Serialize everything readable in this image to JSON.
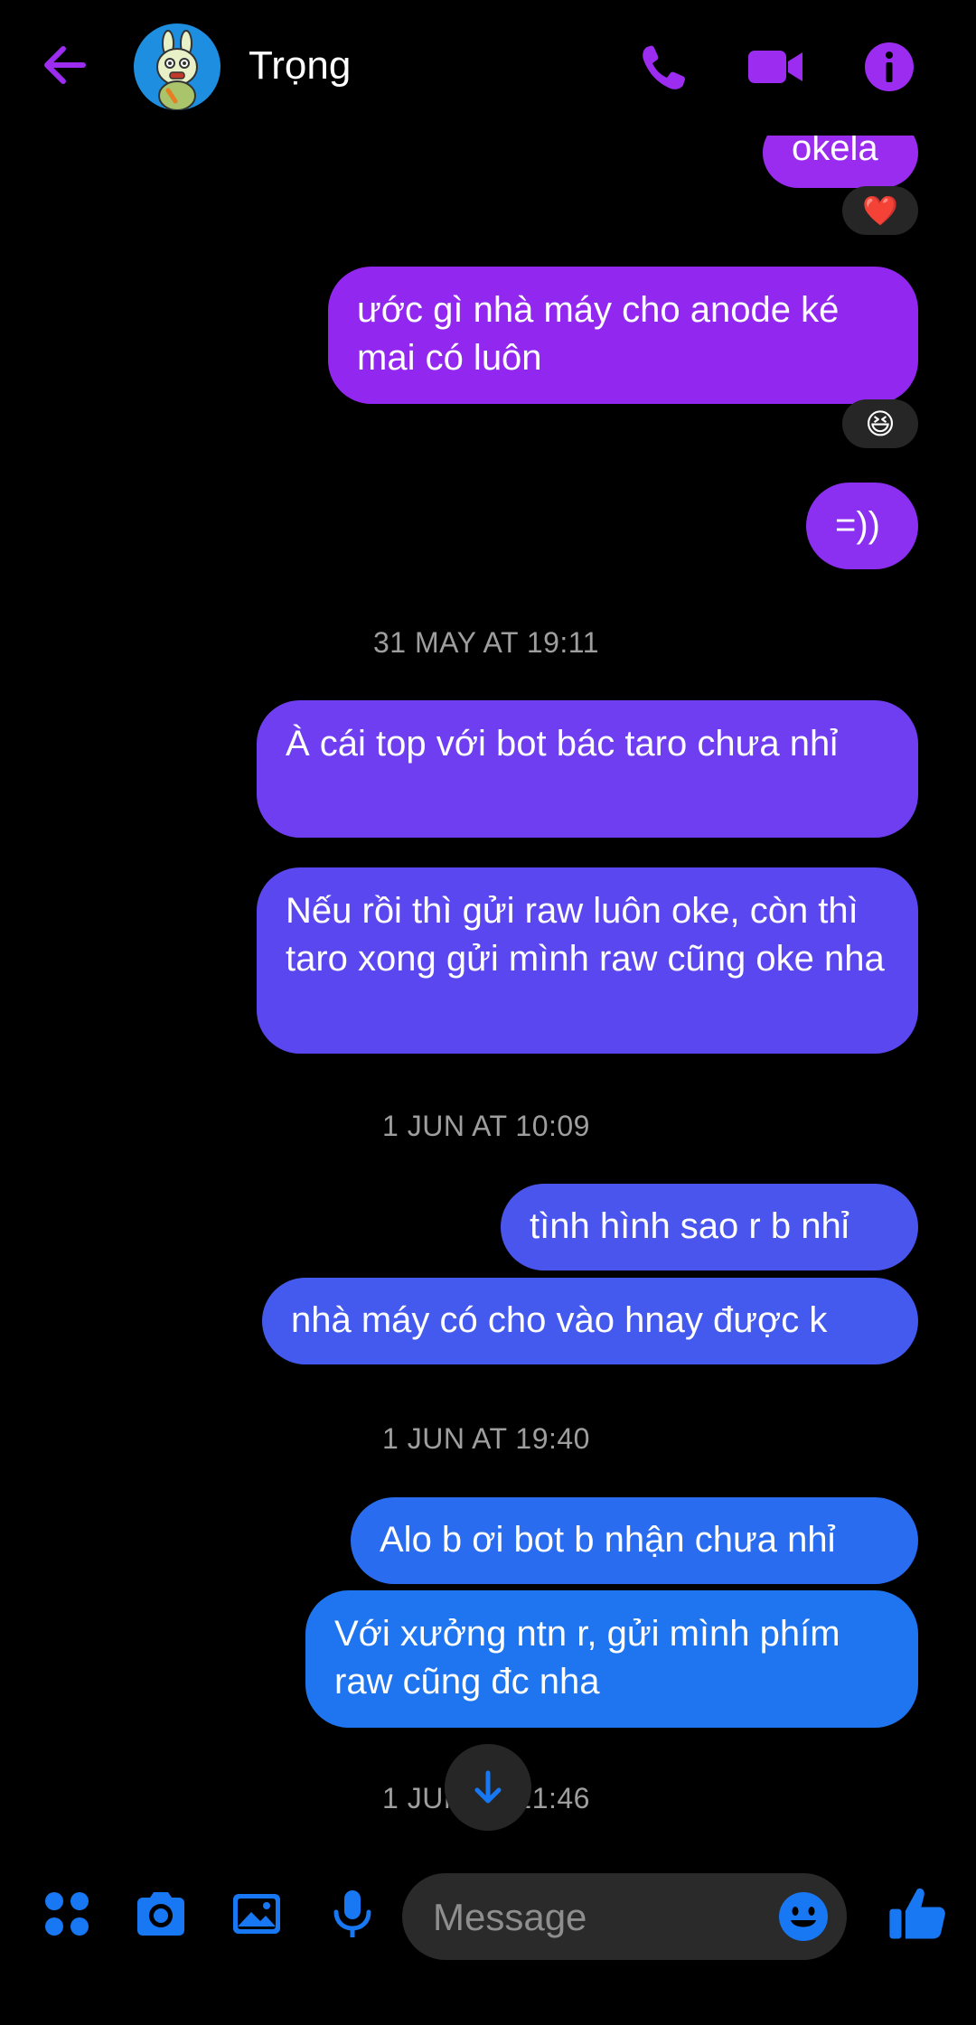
{
  "header": {
    "contact_name": "Trọng",
    "back_icon": "arrow-left-icon",
    "call_icon": "phone-icon",
    "video_icon": "video-camera-icon",
    "info_icon": "info-icon",
    "accent_color": "#9b2cf0"
  },
  "messages": [
    {
      "text": "okela",
      "reaction": "❤️"
    },
    {
      "text": "ước gì nhà máy cho anode ké mai có luôn",
      "reaction": "😆"
    },
    {
      "text": "=))"
    },
    {
      "timestamp": "31 MAY AT 19:11"
    },
    {
      "text": "À cái top với bot bác taro chưa nhỉ"
    },
    {
      "text": "Nếu rồi thì gửi raw luôn oke, còn thì taro xong gửi mình raw cũng oke nha"
    },
    {
      "timestamp": "1 JUN AT 10:09"
    },
    {
      "text": "tình hình sao r b nhỉ"
    },
    {
      "text": "nhà máy có cho vào hnay được k"
    },
    {
      "timestamp": "1 JUN AT 19:40"
    },
    {
      "text": "Alo b ơi bot b nhận chưa nhỉ"
    },
    {
      "text": "Với xưởng ntn r, gửi mình phím raw cũng đc nha"
    },
    {
      "timestamp": "1 JUN AT 21:46"
    }
  ],
  "scroll_down_icon": "arrow-down-icon",
  "composer": {
    "placeholder": "Message",
    "apps_icon": "apps-grid-icon",
    "camera_icon": "camera-icon",
    "gallery_icon": "image-icon",
    "mic_icon": "microphone-icon",
    "emoji_icon": "smiley-icon",
    "like_icon": "thumbs-up-icon",
    "accent_color": "#1877f2"
  }
}
